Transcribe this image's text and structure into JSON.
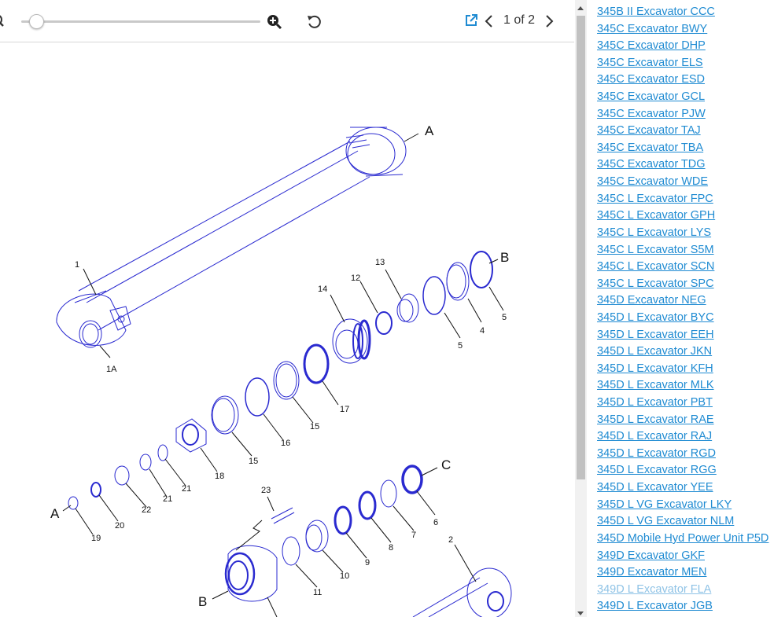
{
  "toolbar": {
    "zoom_out_icon": "zoom-out-icon",
    "zoom_in_icon": "zoom-in-icon",
    "rotate_icon": "rotate-icon",
    "external_link_icon": "external-link-icon",
    "page_indicator": "1 of 2",
    "accent_color": "#1f8bd2"
  },
  "drawing": {
    "labels": {
      "A_top": "A",
      "B_top": "B",
      "C": "C",
      "A_left": "A",
      "B_bottom": "B",
      "p1": "1",
      "p1A": "1A",
      "p2": "2",
      "p4": "4",
      "p5a": "5",
      "p5b": "5",
      "p6": "6",
      "p7": "7",
      "p8": "8",
      "p9": "9",
      "p10": "10",
      "p11": "11",
      "p12": "12",
      "p13": "13",
      "p14": "14",
      "p15a": "15",
      "p15b": "15",
      "p16": "16",
      "p17": "17",
      "p18": "18",
      "p19": "19",
      "p20": "20",
      "p21a": "21",
      "p21b": "21",
      "p22": "22",
      "p23": "23"
    },
    "line_color": "#2a2ad0"
  },
  "sidebar": {
    "links": [
      "345B II Excavator CCC",
      "345C Excavator BWY",
      "345C Excavator DHP",
      "345C Excavator ELS",
      "345C Excavator ESD",
      "345C Excavator GCL",
      "345C Excavator PJW",
      "345C Excavator TAJ",
      "345C Excavator TBA",
      "345C Excavator TDG",
      "345C Excavator WDE",
      "345C L Excavator FPC",
      "345C L Excavator GPH",
      "345C L Excavator LYS",
      "345C L Excavator S5M",
      "345C L Excavator SCN",
      "345C L Excavator SPC",
      "345D Excavator NEG",
      "345D L Excavator BYC",
      "345D L Excavator EEH",
      "345D L Excavator JKN",
      "345D L Excavator KFH",
      "345D L Excavator MLK",
      "345D L Excavator PBT",
      "345D L Excavator RAE",
      "345D L Excavator RAJ",
      "345D L Excavator RGD",
      "345D L Excavator RGG",
      "345D L Excavator YEE",
      "345D L VG Excavator LKY",
      "345D L VG Excavator NLM",
      "345D Mobile Hyd Power Unit P5D",
      "349D Excavator GKF",
      "349D Excavator MEN",
      "349D L Excavator FLA",
      "349D L Excavator JGB"
    ]
  }
}
